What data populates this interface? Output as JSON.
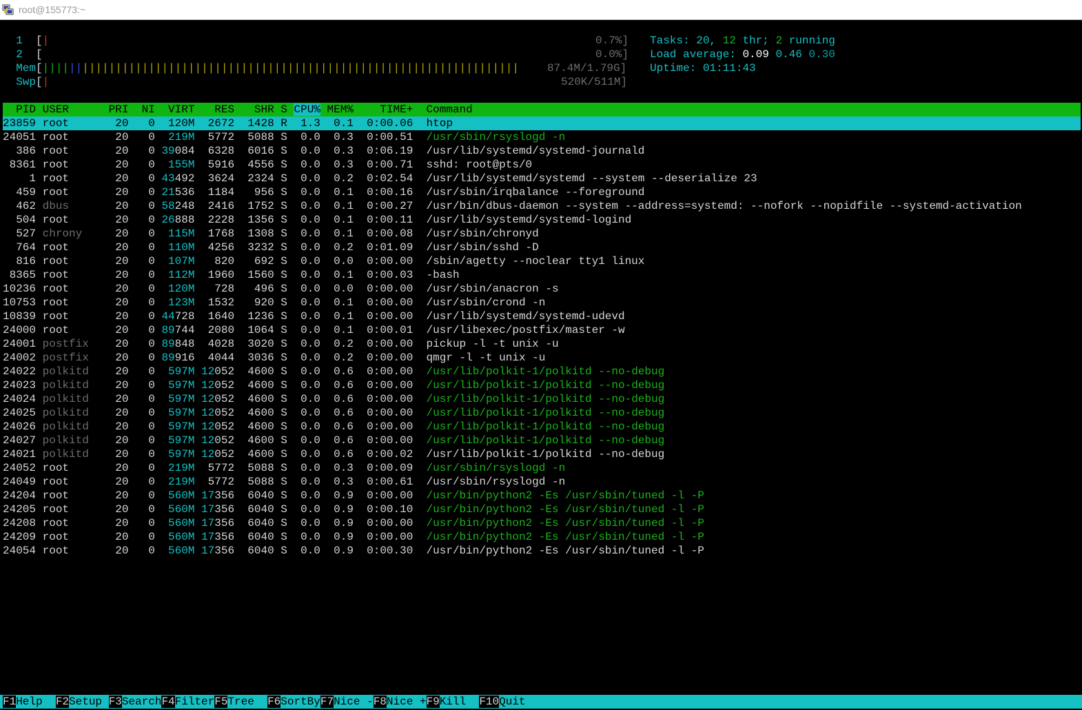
{
  "window": {
    "title": "root@155773:~",
    "icon": "putty-terminal-icon"
  },
  "meters": {
    "cpu1": {
      "label": "1",
      "bar": "[",
      "bar_fill": "|",
      "value": "0.7%]"
    },
    "cpu2": {
      "label": "2",
      "bar": "[",
      "value": "0.0%]"
    },
    "mem": {
      "label": "Mem",
      "bar": "[",
      "green": "||||",
      "blue": "||",
      "yellow": "||||||||||||||||||||||||||||||||||||||||||||||||||||||||||||||||||",
      "value": "87.4M/1.79G]"
    },
    "swp": {
      "label": "Swp",
      "bar": "[",
      "red": "|",
      "value": "520K/511M]"
    }
  },
  "stats": {
    "tasks_label": "Tasks:",
    "tasks_value": "20,",
    "thr_value": "12",
    "thr_label": "thr;",
    "running_value": "2",
    "running_label": "running",
    "load_label": "Load average:",
    "load1": "0.09",
    "load5": "0.46",
    "load15": "0.30",
    "uptime_label": "Uptime:",
    "uptime_value": "01:11:43"
  },
  "columns": {
    "pid": "  PID",
    "user": "USER",
    "pri": "PRI",
    "ni": "NI",
    "virt": "VIRT",
    "res": "RES",
    "shr": "SHR",
    "s": "S",
    "cpu": "CPU%",
    "mem": "MEM%",
    "time": "TIME+",
    "command": "Command"
  },
  "processes": [
    {
      "pid": "23859",
      "user": "root",
      "pri": "20",
      "ni": "0",
      "virt": "120M",
      "res": "2672",
      "shr": "1428",
      "s": "R",
      "cpu": "1.3",
      "mem": "0.1",
      "time": "0:00.06",
      "cmd": "htop"
    },
    {
      "pid": "24051",
      "user": "root",
      "pri": "20",
      "ni": "0",
      "virt": "219M",
      "res": "5772",
      "shr": "5088",
      "s": "S",
      "cpu": "0.0",
      "mem": "0.3",
      "time": "0:00.51",
      "cmd": "/usr/sbin/rsyslogd -n"
    },
    {
      "pid": "386",
      "user": "root",
      "pri": "20",
      "ni": "0",
      "virt": "39084",
      "res": "6328",
      "shr": "6016",
      "s": "S",
      "cpu": "0.0",
      "mem": "0.3",
      "time": "0:06.19",
      "cmd": "/usr/lib/systemd/systemd-journald"
    },
    {
      "pid": "8361",
      "user": "root",
      "pri": "20",
      "ni": "0",
      "virt": "155M",
      "res": "5916",
      "shr": "4556",
      "s": "S",
      "cpu": "0.0",
      "mem": "0.3",
      "time": "0:00.71",
      "cmd": "sshd: root@pts/0"
    },
    {
      "pid": "1",
      "user": "root",
      "pri": "20",
      "ni": "0",
      "virt": "43492",
      "res": "3624",
      "shr": "2324",
      "s": "S",
      "cpu": "0.0",
      "mem": "0.2",
      "time": "0:02.54",
      "cmd": "/usr/lib/systemd/systemd --system --deserialize 23"
    },
    {
      "pid": "459",
      "user": "root",
      "pri": "20",
      "ni": "0",
      "virt": "21536",
      "res": "1184",
      "shr": "956",
      "s": "S",
      "cpu": "0.0",
      "mem": "0.1",
      "time": "0:00.16",
      "cmd": "/usr/sbin/irqbalance --foreground"
    },
    {
      "pid": "462",
      "user": "dbus",
      "pri": "20",
      "ni": "0",
      "virt": "58248",
      "res": "2416",
      "shr": "1752",
      "s": "S",
      "cpu": "0.0",
      "mem": "0.1",
      "time": "0:00.27",
      "cmd": "/usr/bin/dbus-daemon --system --address=systemd: --nofork --nopidfile --systemd-activation"
    },
    {
      "pid": "504",
      "user": "root",
      "pri": "20",
      "ni": "0",
      "virt": "26888",
      "res": "2228",
      "shr": "1356",
      "s": "S",
      "cpu": "0.0",
      "mem": "0.1",
      "time": "0:00.11",
      "cmd": "/usr/lib/systemd/systemd-logind"
    },
    {
      "pid": "527",
      "user": "chrony",
      "pri": "20",
      "ni": "0",
      "virt": "115M",
      "res": "1768",
      "shr": "1308",
      "s": "S",
      "cpu": "0.0",
      "mem": "0.1",
      "time": "0:00.08",
      "cmd": "/usr/sbin/chronyd"
    },
    {
      "pid": "764",
      "user": "root",
      "pri": "20",
      "ni": "0",
      "virt": "110M",
      "res": "4256",
      "shr": "3232",
      "s": "S",
      "cpu": "0.0",
      "mem": "0.2",
      "time": "0:01.09",
      "cmd": "/usr/sbin/sshd -D"
    },
    {
      "pid": "816",
      "user": "root",
      "pri": "20",
      "ni": "0",
      "virt": "107M",
      "res": "820",
      "shr": "692",
      "s": "S",
      "cpu": "0.0",
      "mem": "0.0",
      "time": "0:00.00",
      "cmd": "/sbin/agetty --noclear tty1 linux"
    },
    {
      "pid": "8365",
      "user": "root",
      "pri": "20",
      "ni": "0",
      "virt": "112M",
      "res": "1960",
      "shr": "1560",
      "s": "S",
      "cpu": "0.0",
      "mem": "0.1",
      "time": "0:00.03",
      "cmd": "-bash"
    },
    {
      "pid": "10236",
      "user": "root",
      "pri": "20",
      "ni": "0",
      "virt": "120M",
      "res": "728",
      "shr": "496",
      "s": "S",
      "cpu": "0.0",
      "mem": "0.0",
      "time": "0:00.00",
      "cmd": "/usr/sbin/anacron -s"
    },
    {
      "pid": "10753",
      "user": "root",
      "pri": "20",
      "ni": "0",
      "virt": "123M",
      "res": "1532",
      "shr": "920",
      "s": "S",
      "cpu": "0.0",
      "mem": "0.1",
      "time": "0:00.00",
      "cmd": "/usr/sbin/crond -n"
    },
    {
      "pid": "10839",
      "user": "root",
      "pri": "20",
      "ni": "0",
      "virt": "44728",
      "res": "1640",
      "shr": "1236",
      "s": "S",
      "cpu": "0.0",
      "mem": "0.1",
      "time": "0:00.00",
      "cmd": "/usr/lib/systemd/systemd-udevd"
    },
    {
      "pid": "24000",
      "user": "root",
      "pri": "20",
      "ni": "0",
      "virt": "89744",
      "res": "2080",
      "shr": "1064",
      "s": "S",
      "cpu": "0.0",
      "mem": "0.1",
      "time": "0:00.01",
      "cmd": "/usr/libexec/postfix/master -w"
    },
    {
      "pid": "24001",
      "user": "postfix",
      "pri": "20",
      "ni": "0",
      "virt": "89848",
      "res": "4028",
      "shr": "3020",
      "s": "S",
      "cpu": "0.0",
      "mem": "0.2",
      "time": "0:00.00",
      "cmd": "pickup -l -t unix -u"
    },
    {
      "pid": "24002",
      "user": "postfix",
      "pri": "20",
      "ni": "0",
      "virt": "89916",
      "res": "4044",
      "shr": "3036",
      "s": "S",
      "cpu": "0.0",
      "mem": "0.2",
      "time": "0:00.00",
      "cmd": "qmgr -l -t unix -u"
    },
    {
      "pid": "24022",
      "user": "polkitd",
      "pri": "20",
      "ni": "0",
      "virt": "597M",
      "res": "12052",
      "shr": "4600",
      "s": "S",
      "cpu": "0.0",
      "mem": "0.6",
      "time": "0:00.00",
      "cmd": "/usr/lib/polkit-1/polkitd --no-debug"
    },
    {
      "pid": "24023",
      "user": "polkitd",
      "pri": "20",
      "ni": "0",
      "virt": "597M",
      "res": "12052",
      "shr": "4600",
      "s": "S",
      "cpu": "0.0",
      "mem": "0.6",
      "time": "0:00.00",
      "cmd": "/usr/lib/polkit-1/polkitd --no-debug"
    },
    {
      "pid": "24024",
      "user": "polkitd",
      "pri": "20",
      "ni": "0",
      "virt": "597M",
      "res": "12052",
      "shr": "4600",
      "s": "S",
      "cpu": "0.0",
      "mem": "0.6",
      "time": "0:00.00",
      "cmd": "/usr/lib/polkit-1/polkitd --no-debug"
    },
    {
      "pid": "24025",
      "user": "polkitd",
      "pri": "20",
      "ni": "0",
      "virt": "597M",
      "res": "12052",
      "shr": "4600",
      "s": "S",
      "cpu": "0.0",
      "mem": "0.6",
      "time": "0:00.00",
      "cmd": "/usr/lib/polkit-1/polkitd --no-debug"
    },
    {
      "pid": "24026",
      "user": "polkitd",
      "pri": "20",
      "ni": "0",
      "virt": "597M",
      "res": "12052",
      "shr": "4600",
      "s": "S",
      "cpu": "0.0",
      "mem": "0.6",
      "time": "0:00.00",
      "cmd": "/usr/lib/polkit-1/polkitd --no-debug"
    },
    {
      "pid": "24027",
      "user": "polkitd",
      "pri": "20",
      "ni": "0",
      "virt": "597M",
      "res": "12052",
      "shr": "4600",
      "s": "S",
      "cpu": "0.0",
      "mem": "0.6",
      "time": "0:00.00",
      "cmd": "/usr/lib/polkit-1/polkitd --no-debug"
    },
    {
      "pid": "24021",
      "user": "polkitd",
      "pri": "20",
      "ni": "0",
      "virt": "597M",
      "res": "12052",
      "shr": "4600",
      "s": "S",
      "cpu": "0.0",
      "mem": "0.6",
      "time": "0:00.02",
      "cmd": "/usr/lib/polkit-1/polkitd --no-debug"
    },
    {
      "pid": "24052",
      "user": "root",
      "pri": "20",
      "ni": "0",
      "virt": "219M",
      "res": "5772",
      "shr": "5088",
      "s": "S",
      "cpu": "0.0",
      "mem": "0.3",
      "time": "0:00.09",
      "cmd": "/usr/sbin/rsyslogd -n"
    },
    {
      "pid": "24049",
      "user": "root",
      "pri": "20",
      "ni": "0",
      "virt": "219M",
      "res": "5772",
      "shr": "5088",
      "s": "S",
      "cpu": "0.0",
      "mem": "0.3",
      "time": "0:00.61",
      "cmd": "/usr/sbin/rsyslogd -n"
    },
    {
      "pid": "24204",
      "user": "root",
      "pri": "20",
      "ni": "0",
      "virt": "560M",
      "res": "17356",
      "shr": "6040",
      "s": "S",
      "cpu": "0.0",
      "mem": "0.9",
      "time": "0:00.00",
      "cmd": "/usr/bin/python2 -Es /usr/sbin/tuned -l -P"
    },
    {
      "pid": "24205",
      "user": "root",
      "pri": "20",
      "ni": "0",
      "virt": "560M",
      "res": "17356",
      "shr": "6040",
      "s": "S",
      "cpu": "0.0",
      "mem": "0.9",
      "time": "0:00.10",
      "cmd": "/usr/bin/python2 -Es /usr/sbin/tuned -l -P"
    },
    {
      "pid": "24208",
      "user": "root",
      "pri": "20",
      "ni": "0",
      "virt": "560M",
      "res": "17356",
      "shr": "6040",
      "s": "S",
      "cpu": "0.0",
      "mem": "0.9",
      "time": "0:00.00",
      "cmd": "/usr/bin/python2 -Es /usr/sbin/tuned -l -P"
    },
    {
      "pid": "24209",
      "user": "root",
      "pri": "20",
      "ni": "0",
      "virt": "560M",
      "res": "17356",
      "shr": "6040",
      "s": "S",
      "cpu": "0.0",
      "mem": "0.9",
      "time": "0:00.00",
      "cmd": "/usr/bin/python2 -Es /usr/sbin/tuned -l -P"
    },
    {
      "pid": "24054",
      "user": "root",
      "pri": "20",
      "ni": "0",
      "virt": "560M",
      "res": "17356",
      "shr": "6040",
      "s": "S",
      "cpu": "0.0",
      "mem": "0.9",
      "time": "0:00.30",
      "cmd": "/usr/bin/python2 -Es /usr/sbin/tuned -l -P"
    }
  ],
  "thread_pids": [
    "24051",
    "24022",
    "24023",
    "24024",
    "24025",
    "24026",
    "24027",
    "24052",
    "24204",
    "24205",
    "24208",
    "24209"
  ],
  "dim_users": [
    "dbus",
    "chrony",
    "postfix",
    "polkitd"
  ],
  "footer": [
    {
      "key": "F1",
      "label": "Help  "
    },
    {
      "key": "F2",
      "label": "Setup "
    },
    {
      "key": "F3",
      "label": "Search"
    },
    {
      "key": "F4",
      "label": "Filter"
    },
    {
      "key": "F5",
      "label": "Tree  "
    },
    {
      "key": "F6",
      "label": "SortBy"
    },
    {
      "key": "F7",
      "label": "Nice -"
    },
    {
      "key": "F8",
      "label": "Nice +"
    },
    {
      "key": "F9",
      "label": "Kill  "
    },
    {
      "key": "F10",
      "label": "Quit  "
    }
  ],
  "colors": {
    "cyan": "#15c0c4",
    "green": "#11b511",
    "dim": "#6d6d6d",
    "text": "#d6d6d6"
  }
}
